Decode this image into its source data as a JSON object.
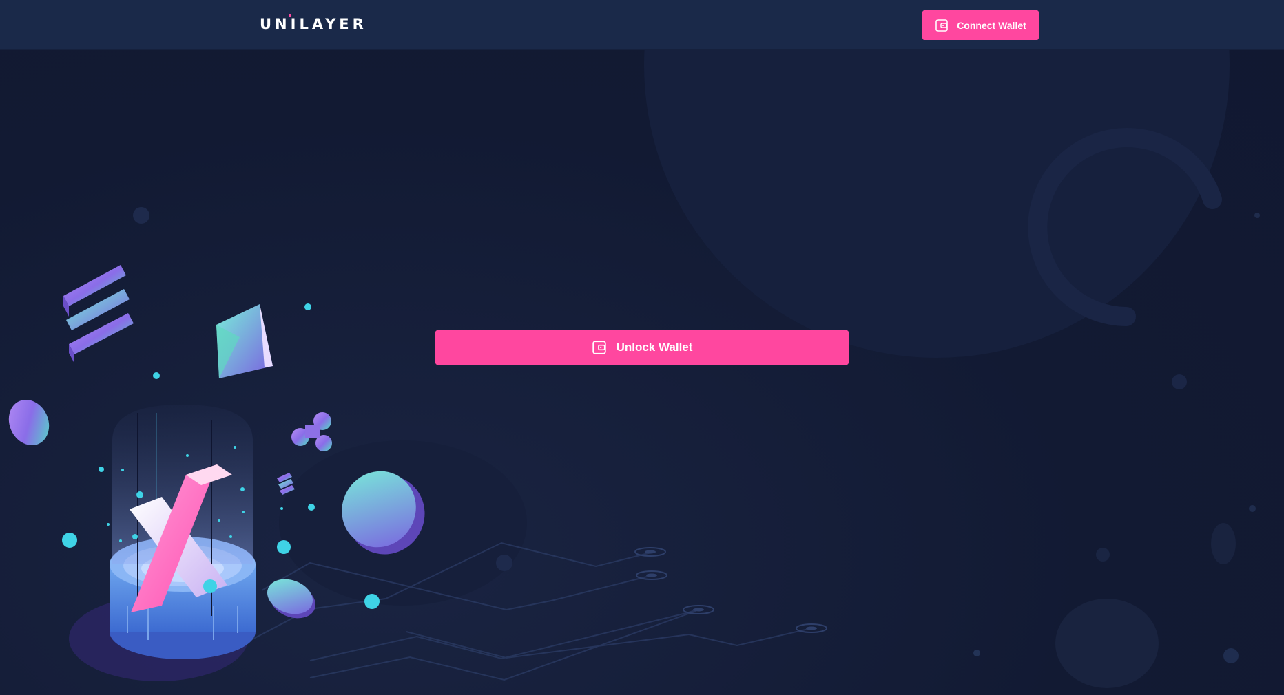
{
  "header": {
    "logo_text": "UNILAYER",
    "connect_label": "Connect Wallet"
  },
  "main": {
    "unlock_label": "Unlock Wallet"
  },
  "colors": {
    "background": "#121a33",
    "header_bg": "#1a2949",
    "accent_pink": "#ff479f",
    "text": "#ffffff"
  },
  "icons": {
    "wallet": "wallet-icon",
    "logo": "unilayer-logo"
  }
}
